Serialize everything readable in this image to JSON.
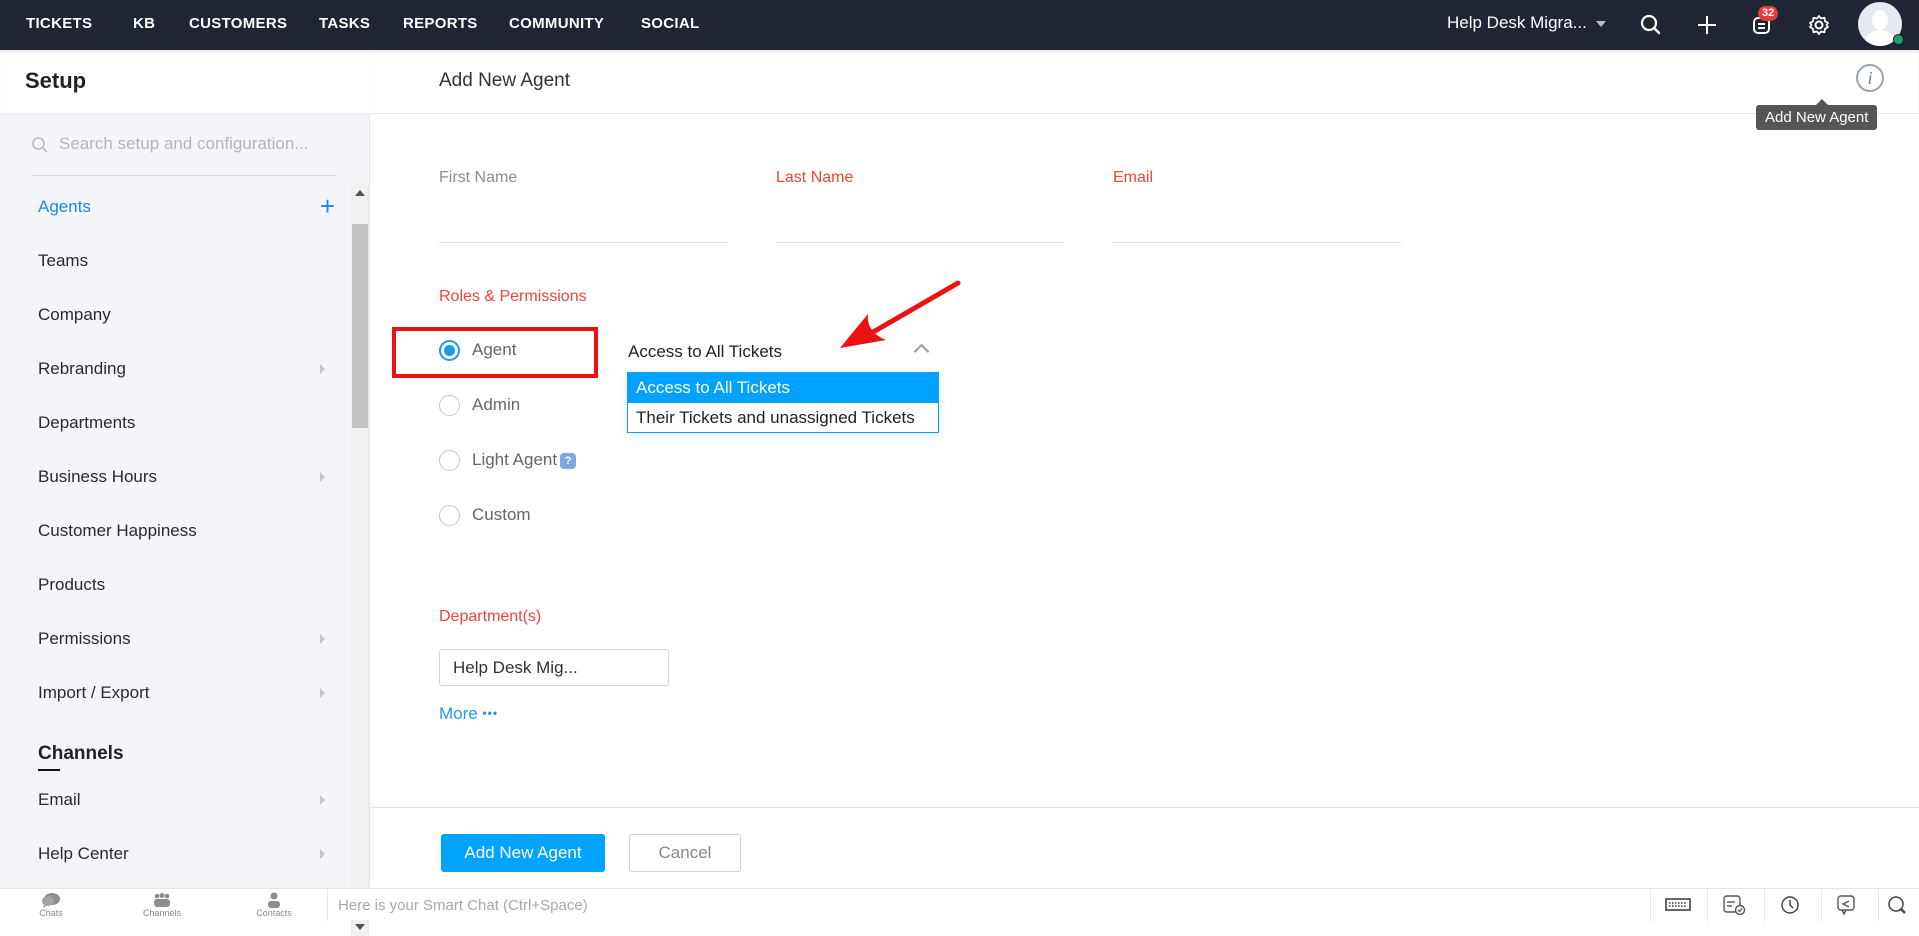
{
  "topnav": {
    "items": [
      "TICKETS",
      "KB",
      "CUSTOMERS",
      "TASKS",
      "REPORTS",
      "COMMUNITY",
      "SOCIAL"
    ],
    "org_name": "Help Desk Migra...",
    "notification_count": "32",
    "icons": [
      "search-icon",
      "plus-icon",
      "notifications-icon",
      "gear-icon",
      "avatar"
    ],
    "online_status_color": "#1ea26b"
  },
  "sidebar": {
    "title": "Setup",
    "search_placeholder": "Search setup and configuration...",
    "items": [
      {
        "label": "Agents",
        "active": true,
        "has_add": true
      },
      {
        "label": "Teams"
      },
      {
        "label": "Company"
      },
      {
        "label": "Rebranding",
        "has_submenu": true
      },
      {
        "label": "Departments"
      },
      {
        "label": "Business Hours",
        "has_submenu": true
      },
      {
        "label": "Customer Happiness"
      },
      {
        "label": "Products"
      },
      {
        "label": "Permissions",
        "has_submenu": true
      },
      {
        "label": "Import / Export",
        "has_submenu": true
      }
    ],
    "section_title": "Channels",
    "channel_items": [
      {
        "label": "Email",
        "has_submenu": true
      },
      {
        "label": "Help Center",
        "has_submenu": true
      }
    ]
  },
  "main": {
    "title": "Add New Agent",
    "info_tooltip": "Add New Agent",
    "fields": [
      {
        "label": "First Name",
        "required": false,
        "value": ""
      },
      {
        "label": "Last Name",
        "required": true,
        "value": ""
      },
      {
        "label": "Email",
        "required": true,
        "value": ""
      }
    ],
    "roles_label": "Roles & Permissions",
    "roles": [
      {
        "label": "Agent",
        "checked": true
      },
      {
        "label": "Admin",
        "checked": false
      },
      {
        "label": "Light Agent",
        "checked": false,
        "help": "?"
      },
      {
        "label": "Custom",
        "checked": false
      }
    ],
    "access_dropdown": {
      "selected": "Access to All Tickets",
      "options": [
        "Access to All Tickets",
        "Their Tickets and unassigned Tickets"
      ],
      "highlighted": "Access to All Tickets"
    },
    "departments_label": "Department(s)",
    "department_value": "Help Desk Mig...",
    "more_label": "More",
    "more_dots": "•••",
    "submit_label": "Add New Agent",
    "cancel_label": "Cancel"
  },
  "bottombar": {
    "tabs": [
      "Chats",
      "Channels",
      "Contacts"
    ],
    "smartchat_placeholder": "Here is your Smart Chat (Ctrl+Space)",
    "right_icons": [
      "keyboard-icon",
      "checklist-icon",
      "clock-icon",
      "share-icon",
      "search-icon"
    ]
  },
  "colors": {
    "accent": "#00a4ff",
    "required": "#f0443a",
    "nav_bg": "#1f2533",
    "annotation": "#ee1111"
  }
}
